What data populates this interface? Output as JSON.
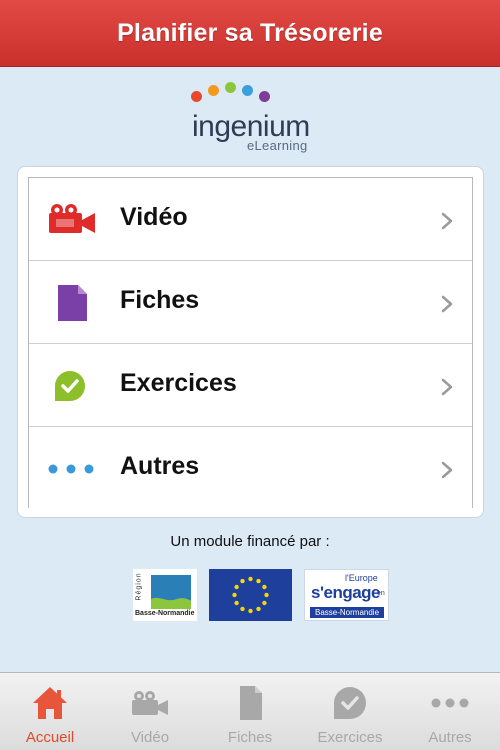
{
  "header": {
    "title": "Planifier sa Trésorerie"
  },
  "logo": {
    "name": "ingenium",
    "sub": "eLearning"
  },
  "menu": {
    "items": [
      {
        "label": "Vidéo",
        "icon": "video-camera-icon"
      },
      {
        "label": "Fiches",
        "icon": "document-icon"
      },
      {
        "label": "Exercices",
        "icon": "check-bubble-icon"
      },
      {
        "label": "Autres",
        "icon": "more-dots-icon"
      }
    ]
  },
  "funding": {
    "text": "Un module financé par :",
    "region": {
      "vertical": "Région",
      "name": "Basse-Normandie"
    },
    "europe_flag": {
      "icon": "eu-flag-icon"
    },
    "europe_engage": {
      "top": "l'Europe",
      "middle": "s'engage",
      "small": "en",
      "bottom": "Basse-Normandie"
    }
  },
  "tabbar": {
    "tabs": [
      {
        "label": "Accueil",
        "icon": "home-icon",
        "active": true
      },
      {
        "label": "Vidéo",
        "icon": "video-camera-icon",
        "active": false
      },
      {
        "label": "Fiches",
        "icon": "document-icon",
        "active": false
      },
      {
        "label": "Exercices",
        "icon": "check-bubble-icon",
        "active": false
      },
      {
        "label": "Autres",
        "icon": "more-dots-icon",
        "active": false
      }
    ]
  },
  "colors": {
    "header": "#d93d38",
    "background": "#dceaf6",
    "active_tab": "#e04a2a",
    "video_icon": "#e02b2b",
    "document_icon": "#7b3fa8",
    "check_icon": "#8cbf2a",
    "dots_icon": "#3a9ad9"
  }
}
